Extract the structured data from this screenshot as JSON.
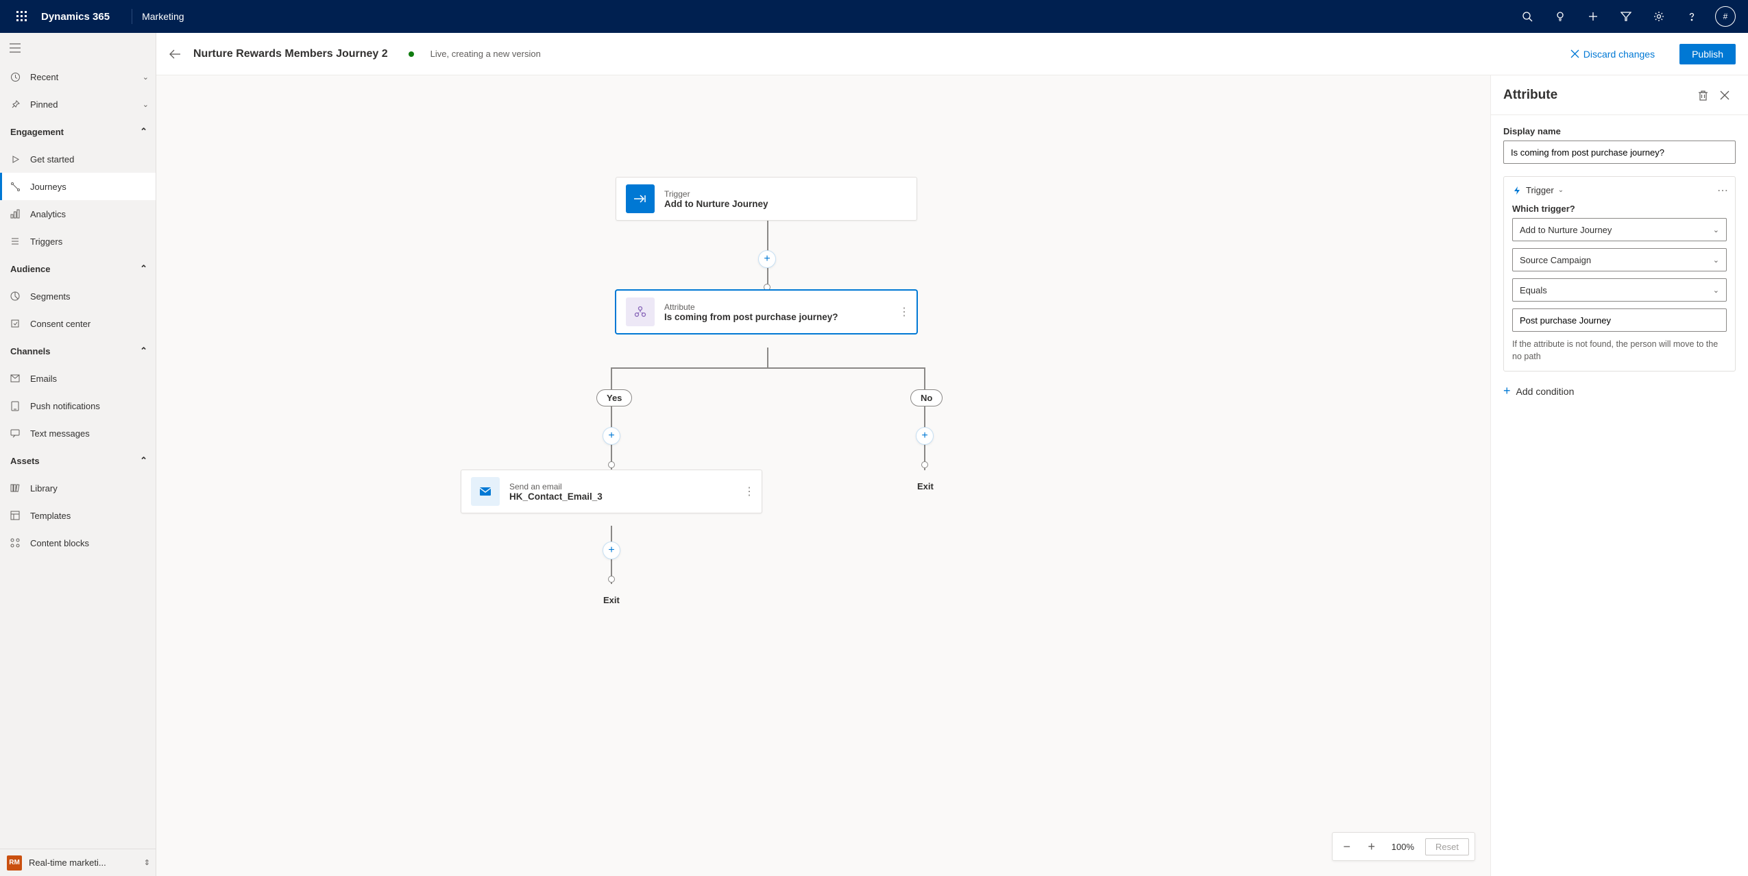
{
  "topbar": {
    "brand": "Dynamics 365",
    "module": "Marketing",
    "avatar": "#"
  },
  "sidebar": {
    "recent": "Recent",
    "pinned": "Pinned",
    "groups": {
      "engagement": "Engagement",
      "audience": "Audience",
      "channels": "Channels",
      "assets": "Assets"
    },
    "items": {
      "get_started": "Get started",
      "journeys": "Journeys",
      "analytics": "Analytics",
      "triggers": "Triggers",
      "segments": "Segments",
      "consent": "Consent center",
      "emails": "Emails",
      "push": "Push notifications",
      "text": "Text messages",
      "library": "Library",
      "templates": "Templates",
      "blocks": "Content blocks"
    },
    "footer_badge": "RM",
    "footer": "Real-time marketi..."
  },
  "header": {
    "title": "Nurture Rewards Members Journey 2",
    "status": "Live, creating a new version",
    "discard": "Discard changes",
    "publish": "Publish"
  },
  "canvas": {
    "trigger": {
      "label": "Trigger",
      "name": "Add to Nurture Journey"
    },
    "attribute": {
      "label": "Attribute",
      "name": "Is coming from post purchase journey?"
    },
    "yes": "Yes",
    "no": "No",
    "email": {
      "label": "Send an email",
      "name": "HK_Contact_Email_3"
    },
    "exit": "Exit"
  },
  "zoom": {
    "value": "100%",
    "reset": "Reset"
  },
  "panel": {
    "title": "Attribute",
    "display_name_label": "Display name",
    "display_name_value": "Is coming from post purchase journey?",
    "trigger_label": "Trigger",
    "which_trigger": "Which trigger?",
    "sel_trigger": "Add to Nurture Journey",
    "sel_field": "Source Campaign",
    "sel_op": "Equals",
    "sel_value": "Post purchase Journey",
    "help": "If the attribute is not found, the person will move to the no path",
    "add_condition": "Add condition"
  }
}
